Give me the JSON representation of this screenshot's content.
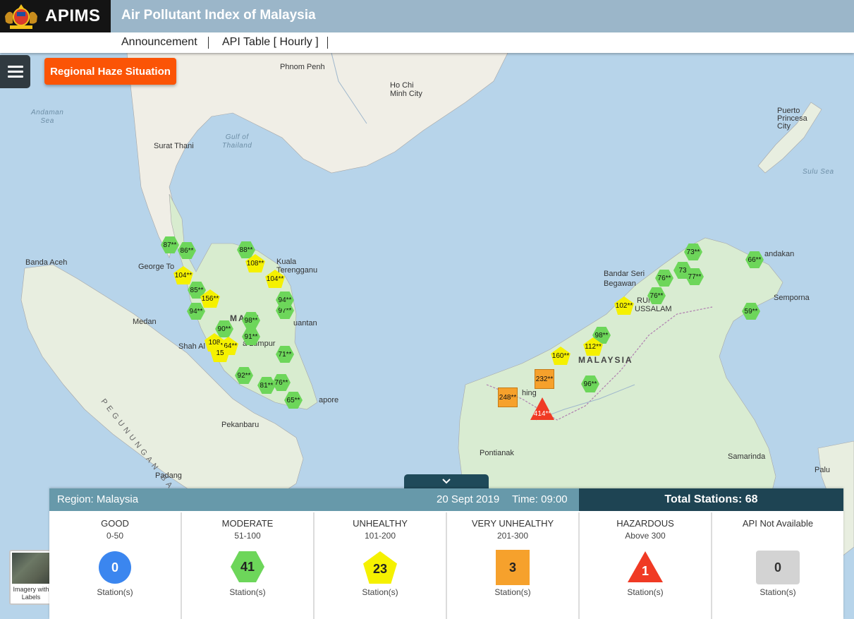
{
  "header": {
    "brand": "APIMS",
    "title": "Air Pollutant Index of Malaysia",
    "nav": [
      "Announcement",
      "API Table [ Hourly ]"
    ]
  },
  "controls": {
    "haze_button": "Regional Haze Situation",
    "basemap_label": "Imagery with Labels"
  },
  "map": {
    "places": [
      {
        "id": "phnom-penh",
        "label": "Phnom Penh"
      },
      {
        "id": "ho-chi-minh",
        "label": "Ho Chi\nMinh City"
      },
      {
        "id": "andaman-sea",
        "label": "Andaman\nSea"
      },
      {
        "id": "gulf-thailand",
        "label": "Gulf of\nThailand"
      },
      {
        "id": "surat-thani",
        "label": "Surat Thani"
      },
      {
        "id": "puerto-princesa",
        "label": "Puerto\nPrincesa\nCity"
      },
      {
        "id": "sulu-sea",
        "label": "Sulu Sea"
      },
      {
        "id": "banda-aceh",
        "label": "Banda Aceh"
      },
      {
        "id": "george-town",
        "label": "George To"
      },
      {
        "id": "kuala-terengganu",
        "label": "Kuala\nTerengganu"
      },
      {
        "id": "kuantan",
        "label": "uantan"
      },
      {
        "id": "medan",
        "label": "Medan"
      },
      {
        "id": "shah-alam",
        "label": "Shah Al"
      },
      {
        "id": "kuala-lumpur",
        "label": "a Lumpur"
      },
      {
        "id": "singapore",
        "label": "apore"
      },
      {
        "id": "pekanbaru",
        "label": "Pekanbaru"
      },
      {
        "id": "padang",
        "label": "Padang"
      },
      {
        "id": "pegunungan",
        "label": "PEGUNUNGAN BARI"
      },
      {
        "id": "bandar-seri-begawan",
        "label": "Bandar Seri\nBegawan"
      },
      {
        "id": "brunei",
        "label": "RUN"
      },
      {
        "id": "darussalam",
        "label": "USSALAM"
      },
      {
        "id": "sandakan",
        "label": "andakan"
      },
      {
        "id": "semporna",
        "label": "Semporna"
      },
      {
        "id": "malaysia-borneo",
        "label": "MALAYSIA"
      },
      {
        "id": "kuching",
        "label": "hing"
      },
      {
        "id": "pontianak",
        "label": "Pontianak"
      },
      {
        "id": "samarinda",
        "label": "Samarinda"
      },
      {
        "id": "palu",
        "label": "Palu"
      },
      {
        "id": "malaysia-pen",
        "label": "MA  SI"
      }
    ],
    "stations": [
      {
        "v": "87**",
        "c": "good"
      },
      {
        "v": "86**",
        "c": "good"
      },
      {
        "v": "104**",
        "c": "unh"
      },
      {
        "v": "85**",
        "c": "good"
      },
      {
        "v": "156**",
        "c": "unh"
      },
      {
        "v": "94**",
        "c": "good"
      },
      {
        "v": "88**",
        "c": "good"
      },
      {
        "v": "108**",
        "c": "unh"
      },
      {
        "v": "104**",
        "c": "unh"
      },
      {
        "v": "90**",
        "c": "good"
      },
      {
        "v": "98**",
        "c": "good"
      },
      {
        "v": "91**",
        "c": "good"
      },
      {
        "v": "108",
        "c": "unh"
      },
      {
        "v": "164**",
        "c": "unh"
      },
      {
        "v": "15",
        "c": "unh"
      },
      {
        "v": "97**",
        "c": "good"
      },
      {
        "v": "94**",
        "c": "good"
      },
      {
        "v": "71**",
        "c": "good"
      },
      {
        "v": "92**",
        "c": "good"
      },
      {
        "v": "81**",
        "c": "good"
      },
      {
        "v": "76**",
        "c": "good"
      },
      {
        "v": "65**",
        "c": "good"
      },
      {
        "v": "73**",
        "c": "good"
      },
      {
        "v": "73",
        "c": "good"
      },
      {
        "v": "77**",
        "c": "good"
      },
      {
        "v": "76**",
        "c": "good"
      },
      {
        "v": "76**",
        "c": "good"
      },
      {
        "v": "66**",
        "c": "good"
      },
      {
        "v": "59**",
        "c": "good"
      },
      {
        "v": "102**",
        "c": "unh"
      },
      {
        "v": "98**",
        "c": "good"
      },
      {
        "v": "112**",
        "c": "unh"
      },
      {
        "v": "160**",
        "c": "unh"
      },
      {
        "v": "96**",
        "c": "good"
      },
      {
        "v": "232**",
        "c": "vunh"
      },
      {
        "v": "248**",
        "c": "vunh"
      },
      {
        "v": "414**",
        "c": "haz"
      }
    ]
  },
  "panel": {
    "region": "Region: Malaysia",
    "date": "20 Sept 2019",
    "time": "Time: 09:00",
    "total": "Total Stations: 68",
    "categories": [
      {
        "name": "GOOD",
        "range": "0-50",
        "count": "0",
        "sub": "Station(s)",
        "color": "#3b86ef"
      },
      {
        "name": "MODERATE",
        "range": "51-100",
        "count": "41",
        "sub": "Station(s)",
        "color": "#6dd65a"
      },
      {
        "name": "UNHEALTHY",
        "range": "101-200",
        "count": "23",
        "sub": "Station(s)",
        "color": "#f5f100"
      },
      {
        "name": "VERY UNHEALTHY",
        "range": "201-300",
        "count": "3",
        "sub": "Station(s)",
        "color": "#f6a12c"
      },
      {
        "name": "HAZARDOUS",
        "range": "Above 300",
        "count": "1",
        "sub": "Station(s)",
        "color": "#f03a24"
      },
      {
        "name": "API Not Available",
        "range": "",
        "count": "0",
        "sub": "Station(s)",
        "color": "#d3d3d3"
      }
    ]
  }
}
